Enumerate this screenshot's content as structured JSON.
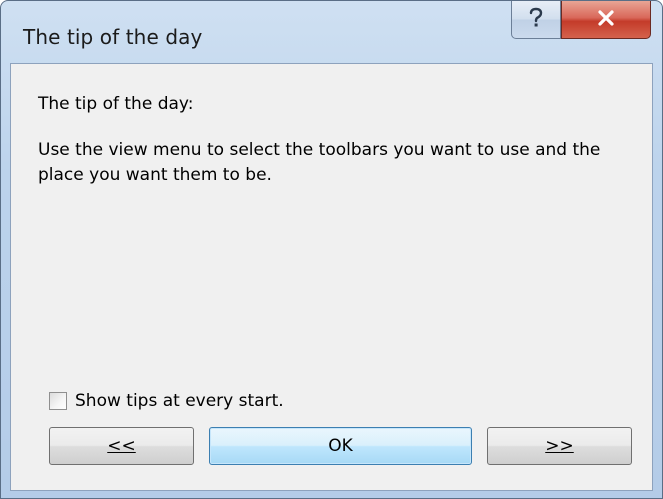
{
  "window": {
    "title": "The tip of the day"
  },
  "titlebar_buttons": {
    "help_icon": "question-mark",
    "close_icon": "x"
  },
  "content": {
    "heading": "The tip of the day:",
    "tip": "Use the view menu to select the toolbars you want to use and the place you want them to be."
  },
  "checkbox": {
    "label": "Show tips at every start.",
    "checked": false
  },
  "buttons": {
    "previous_label": "<<",
    "ok_label": "OK",
    "next_label": ">>"
  },
  "colors": {
    "close_button": "#c43b2a",
    "ok_button_border": "#3c7fb1",
    "frame": "#b4cce8",
    "client": "#f0f0f0"
  }
}
